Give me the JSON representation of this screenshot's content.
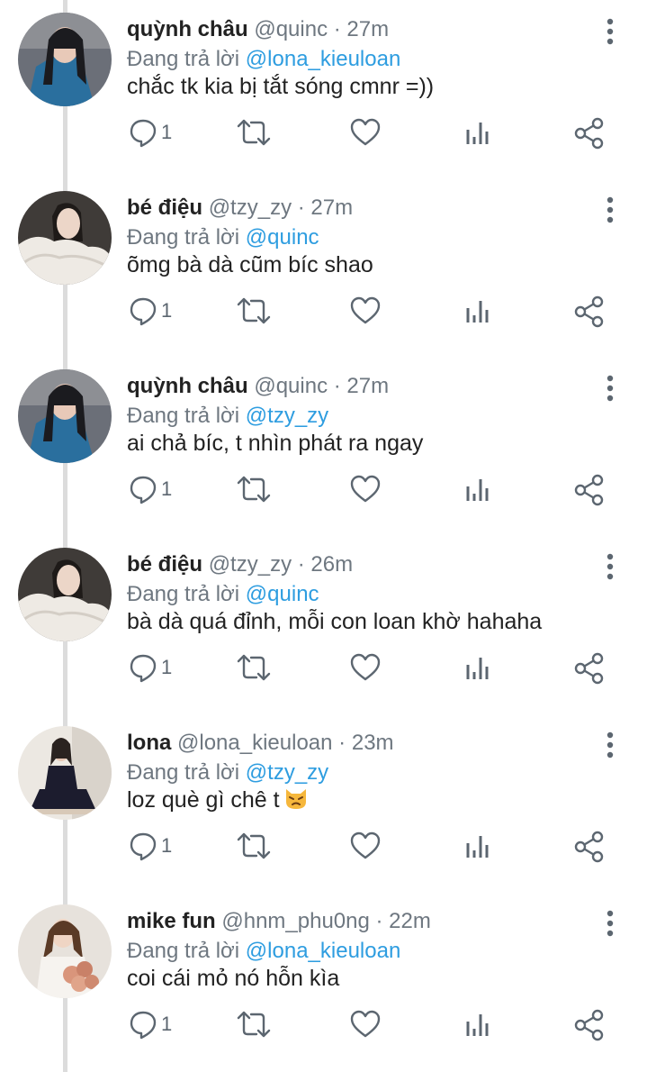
{
  "reply_prefix": "Đang trả lời",
  "tweets": [
    {
      "name": "quỳnh châu",
      "handle": "@quinc",
      "sep": " · ",
      "time": "27m",
      "reply_to": "@lona_kieuloan",
      "text": "chắc tk kia bị tắt sóng cmnr =))",
      "replies": "1",
      "avatar": "avatar-quynh"
    },
    {
      "name": "bé điệu",
      "handle": "@tzy_zy",
      "sep": " · ",
      "time": "27m",
      "reply_to": "@quinc",
      "text": "õmg bà dà cũm bíc shao",
      "replies": "1",
      "avatar": "avatar-dieu"
    },
    {
      "name": "quỳnh châu",
      "handle": "@quinc",
      "sep": " · ",
      "time": "27m",
      "reply_to": "@tzy_zy",
      "text": "ai chả bíc, t nhìn phát ra ngay",
      "replies": "1",
      "avatar": "avatar-quynh"
    },
    {
      "name": "bé điệu",
      "handle": "@tzy_zy",
      "sep": " · ",
      "time": "26m",
      "reply_to": "@quinc",
      "text": "bà dà quá đỉnh, mỗi con loan khờ hahaha",
      "replies": "1",
      "avatar": "avatar-dieu"
    },
    {
      "name": "lona ",
      "handle": "@lona_kieuloan",
      "sep": " · ",
      "time": "23m",
      "reply_to": "@tzy_zy",
      "text": "loz què gì chê t",
      "replies": "1",
      "avatar": "avatar-lona",
      "emoji": "angry-cat-emoji"
    },
    {
      "name": "mike fun",
      "handle": "@hnm_phu0ng",
      "sep": " · ",
      "time": "22m",
      "reply_to": "@lona_kieuloan",
      "text": "coi cái mỏ nó hỗn kìa",
      "replies": "1",
      "avatar": "avatar-mike"
    }
  ],
  "colors": {
    "mention": "#2e9de0",
    "icon": "#5c6670",
    "meta": "#6e7780",
    "thread_line": "#dcdcdc"
  },
  "icons": [
    "reply-icon",
    "retweet-icon",
    "like-icon",
    "stats-icon",
    "share-icon",
    "more-icon"
  ]
}
